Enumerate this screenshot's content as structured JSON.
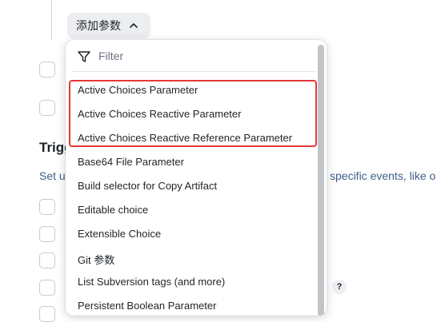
{
  "add_button": {
    "label": "添加参数"
  },
  "section": {
    "heading": "Trigg",
    "description_left": "Set u",
    "description_right": "specific events, like o"
  },
  "help": {
    "label": "?"
  },
  "menu": {
    "filter_placeholder": "Filter",
    "items": [
      "Active Choices Parameter",
      "Active Choices Reactive Parameter",
      "Active Choices Reactive Reference Parameter",
      "Base64 File Parameter",
      "Build selector for Copy Artifact",
      "Editable choice",
      "Extensible Choice",
      "Git 参数",
      "List Subversion tags (and more)",
      "Persistent Boolean Parameter"
    ]
  },
  "colors": {
    "highlight": "#e53935",
    "link_text": "#3d5f8a",
    "button_bg": "#eceef1"
  },
  "icons": [
    "chevron-up-icon",
    "filter-funnel-icon",
    "help-icon"
  ]
}
